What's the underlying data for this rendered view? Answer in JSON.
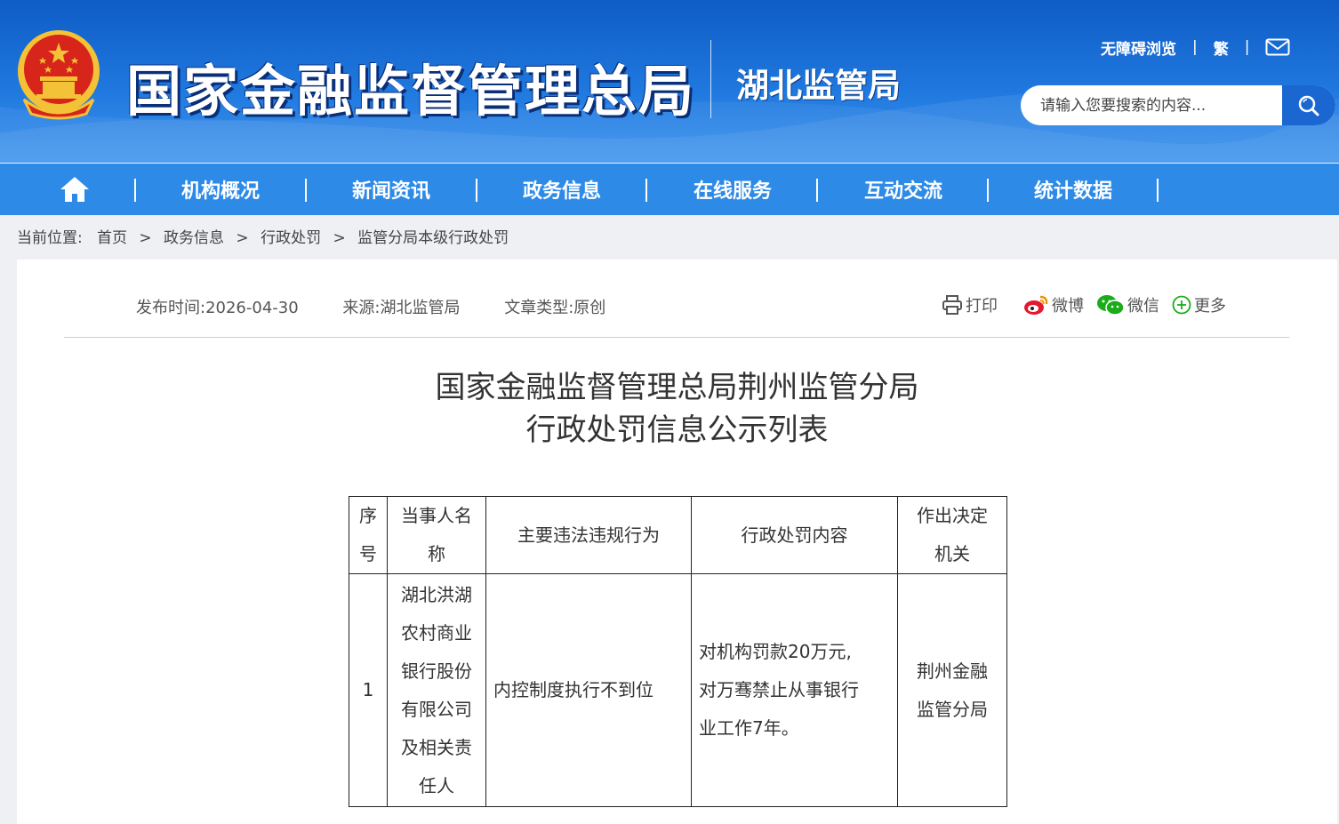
{
  "header": {
    "site_title": "国家金融监督管理总局",
    "sub_title": "湖北监管局",
    "accessibility_link": "无障碍浏览",
    "traditional_link": "繁",
    "link_separator": "|",
    "search": {
      "placeholder": "请输入您要搜索的内容..."
    }
  },
  "nav": {
    "items": [
      {
        "label": "机构概况"
      },
      {
        "label": "新闻资讯"
      },
      {
        "label": "政务信息"
      },
      {
        "label": "在线服务"
      },
      {
        "label": "互动交流"
      },
      {
        "label": "统计数据"
      }
    ]
  },
  "breadcrumb": {
    "prefix": "当前位置:",
    "items": [
      "首页",
      "政务信息",
      "行政处罚",
      "监管分局本级行政处罚"
    ],
    "separator": ">"
  },
  "article": {
    "meta": {
      "publish_time": "发布时间:2026-04-30",
      "source": "来源:湖北监管局",
      "type": "文章类型:原创"
    },
    "share": {
      "print": "打印",
      "weibo": "微博",
      "wechat": "微信",
      "more": "更多"
    },
    "title_line1": "国家金融监督管理总局荆州监管分局",
    "title_line2": "行政处罚信息公示列表",
    "table": {
      "headers": {
        "seq": [
          "序",
          "号"
        ],
        "party": [
          "当事人名",
          "称"
        ],
        "violation": "主要违法违规行为",
        "penalty": "行政处罚内容",
        "authority": [
          "作出决定",
          "机关"
        ]
      },
      "rows": [
        {
          "seq": "1",
          "party": [
            "湖北洪湖",
            "农村商业",
            "银行股份",
            "有限公司",
            "及相关责",
            "任人"
          ],
          "violation": "内控制度执行不到位",
          "penalty": [
            "对机构罚款20万元,",
            "对万骞禁止从事银行",
            "业工作7年。"
          ],
          "authority": [
            "荆州金融",
            "监管分局"
          ]
        }
      ]
    }
  },
  "colors": {
    "header_blue": "#1f78de",
    "nav_blue": "#2d8ae6",
    "search_button": "#1b67d2",
    "emblem_red": "#d8251c",
    "emblem_gold": "#f4c236"
  }
}
